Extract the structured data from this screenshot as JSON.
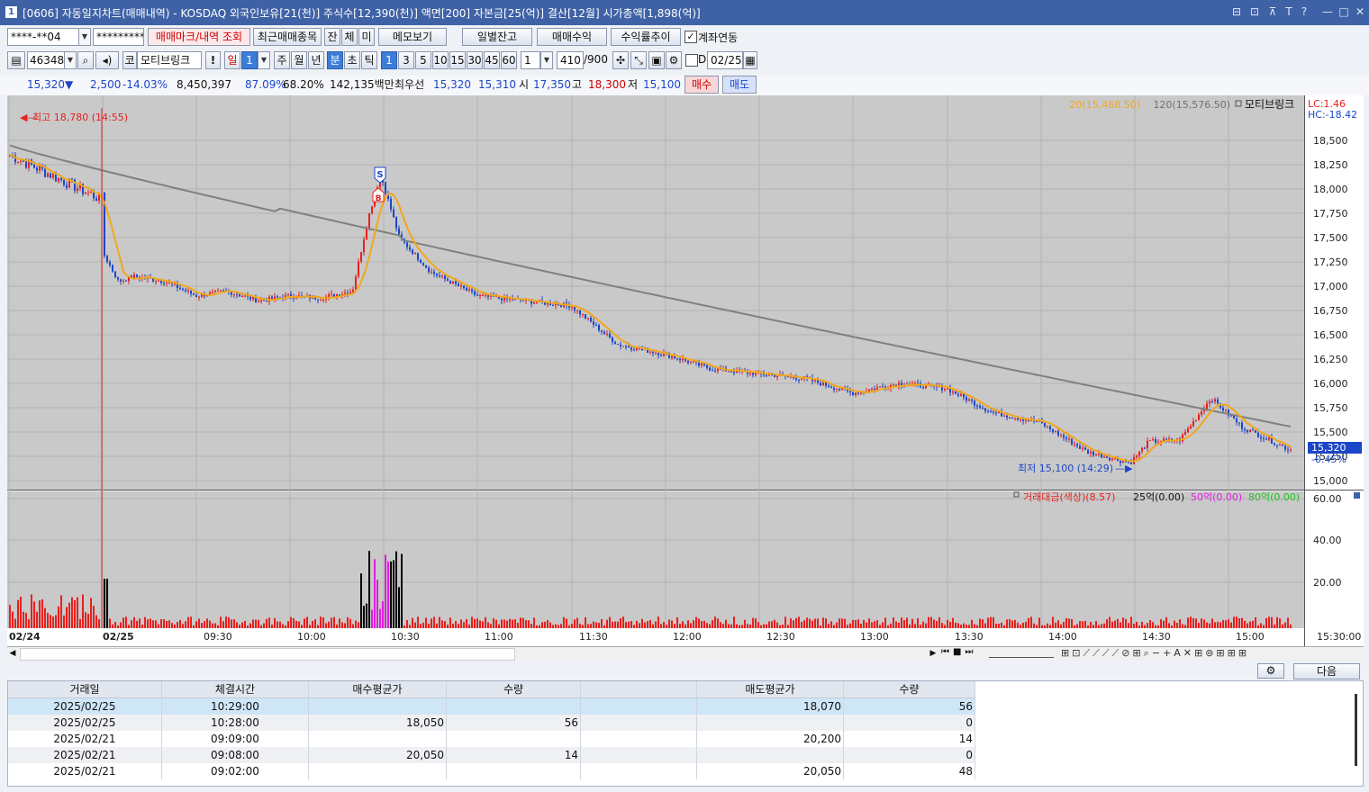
{
  "window": {
    "title": "[0606] 자동일지차트(매매내역) - KOSDAQ 외국인보유[21(천)] 주식수[12,390(천)] 액면[200] 자본금[25(억)] 결산[12월] 시가총액[1,898(억)]",
    "app_badge": "1",
    "buttons": [
      "⊟",
      "⊡",
      "⊼",
      "T",
      "?",
      "—",
      "□",
      "✕"
    ]
  },
  "toolbar1": {
    "account": "****-**04",
    "password": "*********",
    "btn_marks": "매매마크/내역 조회",
    "btn_recent": "최근매매종목",
    "btn_jan": "잔",
    "btn_che": "체",
    "btn_mi": "미",
    "btn_memo": "메모보기",
    "btn_daily": "일별잔고",
    "btn_trade_profit": "매매수익",
    "btn_yield": "수익률추이",
    "account_link_label": "계좌연동",
    "account_link_checked": true
  },
  "toolbar2": {
    "code": "463480",
    "market": "코",
    "name": "모티브링크",
    "periods": [
      "일",
      "1",
      "주",
      "월",
      "년",
      "분",
      "초",
      "틱"
    ],
    "selected_period": "분",
    "intervals": [
      "1",
      "3",
      "5",
      "10",
      "15",
      "30",
      "45",
      "60"
    ],
    "selected_interval": "1",
    "count_value": "1",
    "bars": "410",
    "bars_total": "/900",
    "d_label": "D",
    "date": "02/25"
  },
  "quote": {
    "price": "15,320",
    "arrow": "▼",
    "change": "2,500",
    "rate": "-14.03%",
    "volume": "8,450,397",
    "ratio1": "87.09%",
    "ratio2": "68.20%",
    "amount": "142,135백만",
    "best_label": "최우선",
    "ask": "15,320",
    "bid": "15,310",
    "open_label": "시",
    "open": "17,350",
    "high_label": "고",
    "high": "18,300",
    "low_label": "저",
    "low": "15,100",
    "buy": "매수",
    "sell": "매도"
  },
  "chart": {
    "legend_ma20": "20(15,468.50)",
    "legend_ma120": "120(15,576.50)",
    "legend_name": "모티브링크",
    "lc": "LC:1.46",
    "hc": "HC:-18.42",
    "y_ticks": [
      "18,500",
      "18,250",
      "18,000",
      "17,750",
      "17,500",
      "17,250",
      "17,000",
      "16,750",
      "16,500",
      "16,250",
      "16,000",
      "15,750",
      "15,500",
      "15,250",
      "15,000"
    ],
    "cur_price": "15,320",
    "cur_pct": "-0.45%",
    "high_note": "최고 18,780 (14:55)",
    "low_note": "최저 15,100 (14:29)",
    "marker_s": "S",
    "marker_b": "B",
    "vol_legend": [
      "거래대금(색상)(8.57)",
      "25억(0.00)",
      "50억(0.00)",
      "80억(0.00)"
    ],
    "vol_ticks": [
      "60.00",
      "40.00",
      "20.00"
    ],
    "x_ticks": [
      "02/24",
      "02/25",
      "09:30",
      "10:00",
      "10:30",
      "11:00",
      "11:30",
      "12:00",
      "12:30",
      "13:00",
      "13:30",
      "14:00",
      "14:30",
      "15:00",
      "15:30:00"
    ],
    "colors": {
      "up": "#e8201e",
      "down": "#1c46c8",
      "ma20": "#f2a71b",
      "ma120": "#808080",
      "bg": "#c9c9c9"
    }
  },
  "chart_data": {
    "type": "line",
    "title": "모티브링크",
    "x": [
      "09:00",
      "09:05",
      "09:10",
      "09:20",
      "09:30",
      "09:40",
      "09:50",
      "10:00",
      "10:10",
      "10:20",
      "10:25",
      "10:29",
      "10:35",
      "10:45",
      "11:00",
      "11:15",
      "11:30",
      "11:45",
      "12:00",
      "12:15",
      "12:30",
      "12:45",
      "13:00",
      "13:15",
      "13:30",
      "13:45",
      "14:00",
      "14:15",
      "14:29",
      "14:35",
      "14:45",
      "14:55",
      "15:05",
      "15:20"
    ],
    "series": [
      {
        "name": "Price",
        "values": [
          17350,
          17050,
          17100,
          17050,
          16900,
          16950,
          16850,
          16900,
          16880,
          16950,
          17700,
          18150,
          17500,
          17150,
          16900,
          16850,
          16800,
          16400,
          16300,
          16150,
          16100,
          16050,
          15900,
          16000,
          15950,
          15700,
          15600,
          15300,
          15180,
          15400,
          15420,
          15850,
          15550,
          15320
        ]
      }
    ],
    "ylim": [
      15000,
      18600
    ],
    "reference_high": {
      "label": "최고 18,780 (14:55)"
    },
    "reference_low": {
      "label": "최저 15,100 (14:29)"
    }
  },
  "bottom": {
    "btn_next": "다음"
  },
  "table": {
    "headers": [
      "거래일",
      "체결시간",
      "매수평균가",
      "수량",
      "",
      "매도평균가",
      "수량"
    ],
    "rows": [
      [
        "2025/02/25",
        "10:29:00",
        "",
        "",
        "",
        "18,070",
        "56"
      ],
      [
        "2025/02/25",
        "10:28:00",
        "18,050",
        "56",
        "",
        "",
        "0"
      ],
      [
        "2025/02/21",
        "09:09:00",
        "",
        "",
        "",
        "20,200",
        "14"
      ],
      [
        "2025/02/21",
        "09:08:00",
        "20,050",
        "14",
        "",
        "",
        "0"
      ],
      [
        "2025/02/21",
        "09:02:00",
        "",
        "",
        "",
        "20,050",
        "48"
      ]
    ]
  }
}
